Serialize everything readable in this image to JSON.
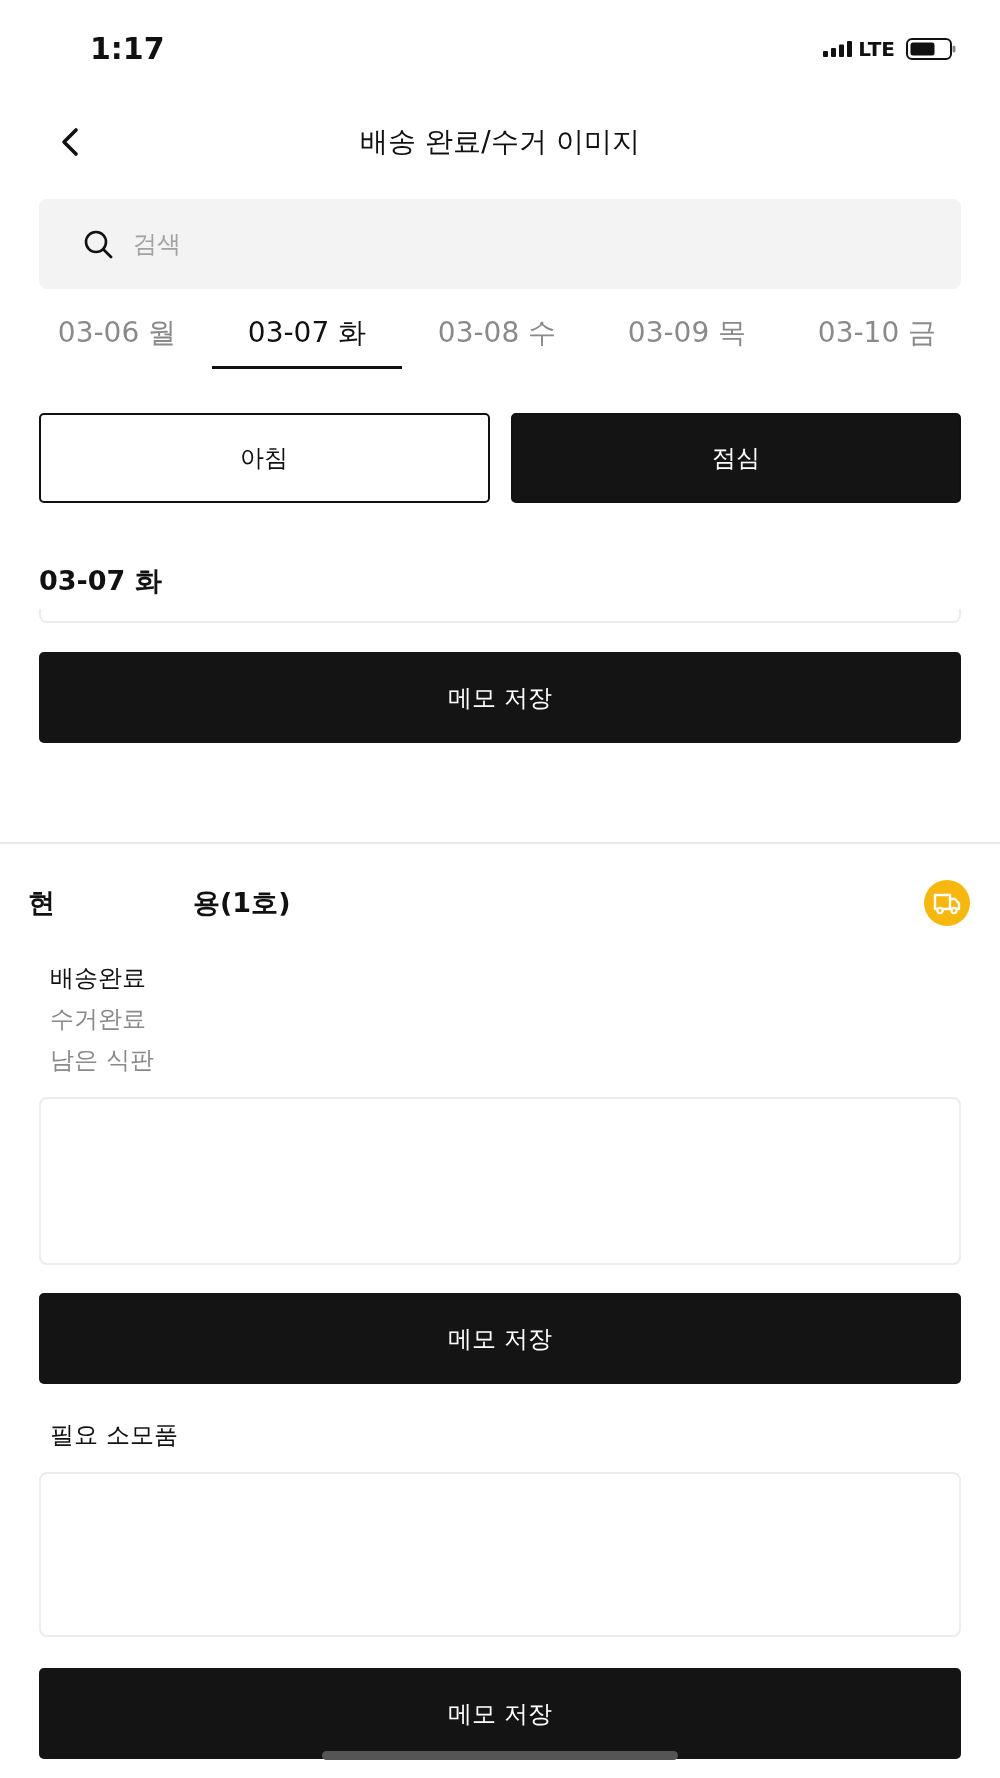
{
  "status_bar": {
    "time": "1:17",
    "network": "LTE"
  },
  "header": {
    "title": "배송 완료/수거 이미지"
  },
  "search": {
    "placeholder": "검색"
  },
  "date_tabs": [
    {
      "label": "03-06 월",
      "selected": false
    },
    {
      "label": "03-07 화",
      "selected": true
    },
    {
      "label": "03-08 수",
      "selected": false
    },
    {
      "label": "03-09 목",
      "selected": false
    },
    {
      "label": "03-10 금",
      "selected": false
    }
  ],
  "meal_toggle": [
    {
      "label": "아침",
      "selected": false
    },
    {
      "label": "점심",
      "selected": true
    }
  ],
  "day_section": {
    "heading": "03-07 화",
    "save_button": "메모 저장"
  },
  "site": {
    "title_parts": [
      "현",
      "용(1호)"
    ],
    "status_options": [
      {
        "label": "배송완료",
        "selected": true
      },
      {
        "label": "수거완료",
        "selected": false
      },
      {
        "label": "남은 식판",
        "selected": false
      }
    ],
    "save_button": "메모 저장"
  },
  "supplies": {
    "label": "필요 소모품",
    "save_button": "메모 저장"
  }
}
